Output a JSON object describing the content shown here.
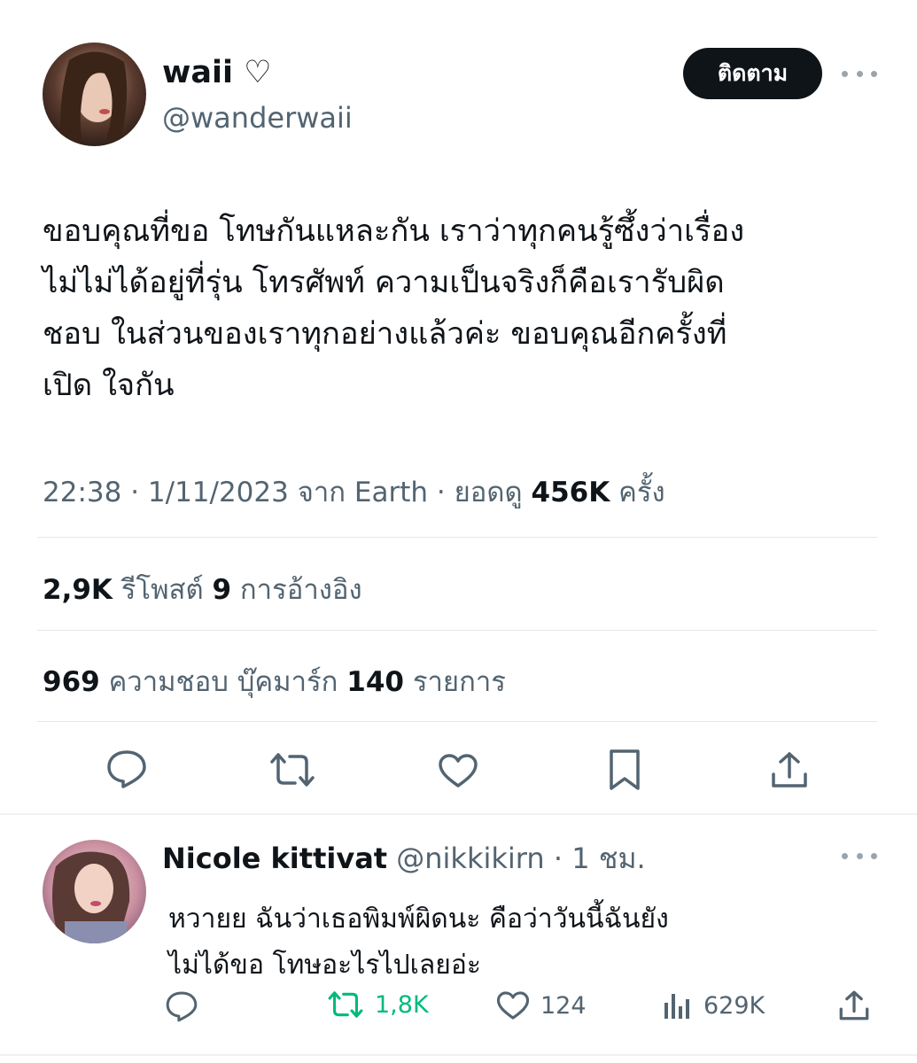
{
  "tweet": {
    "author": {
      "display_name": "waii ♡",
      "handle": "@wanderwaii"
    },
    "follow_label": "ติดตาม",
    "text_lines": [
      "ขอบคุณที่ขอ โทษกันแหละกัน เราว่าทุกคนรู้ซึ้งว่าเรื่อง",
      "ไม่ไม่ได้อยู่ที่รุ่น โทรศัพท์ ความเป็นจริงก็คือเรารับผิด",
      "ชอบ ในส่วนของเราทุกอย่างแล้วค่ะ ขอบคุณอีกครั้งที่",
      "เปิด ใจกัน"
    ],
    "meta": {
      "time_date_source": "22:38 · 1/11/2023 จาก Earth · ยอดดู ",
      "views": "456K",
      "views_suffix": " ครั้ง"
    },
    "stats": {
      "reposts_count": "2,9K",
      "reposts_label": " รีโพสต์  ",
      "quotes_count": "9",
      "quotes_label": " การอ้างอิง",
      "likes_count": "969",
      "likes_label": " ความชอบ  บุ๊คมาร์ก ",
      "bookmarks_count": "140",
      "bookmarks_label": " รายการ"
    },
    "actions": [
      "reply-icon",
      "repost-icon",
      "like-icon",
      "bookmark-icon",
      "share-icon"
    ]
  },
  "reply": {
    "author": {
      "display_name": "Nicole kittivat",
      "handle": " @nikkikirn · 1 ชม."
    },
    "text_lines": [
      "หวายย  ฉันว่าเธอพิมพ์ผิดนะ  คือว่าวันนี้ฉันยัง",
      "ไม่ได้ขอ โทษอะไรไปเลยอ่ะ"
    ],
    "actions": {
      "reposts": "1,8K",
      "likes": "124",
      "views": "629K"
    }
  },
  "colors": {
    "text": "#0f1419",
    "secondary": "#536471",
    "repost_active": "#00ba7c",
    "divider": "#e3e6e8"
  }
}
